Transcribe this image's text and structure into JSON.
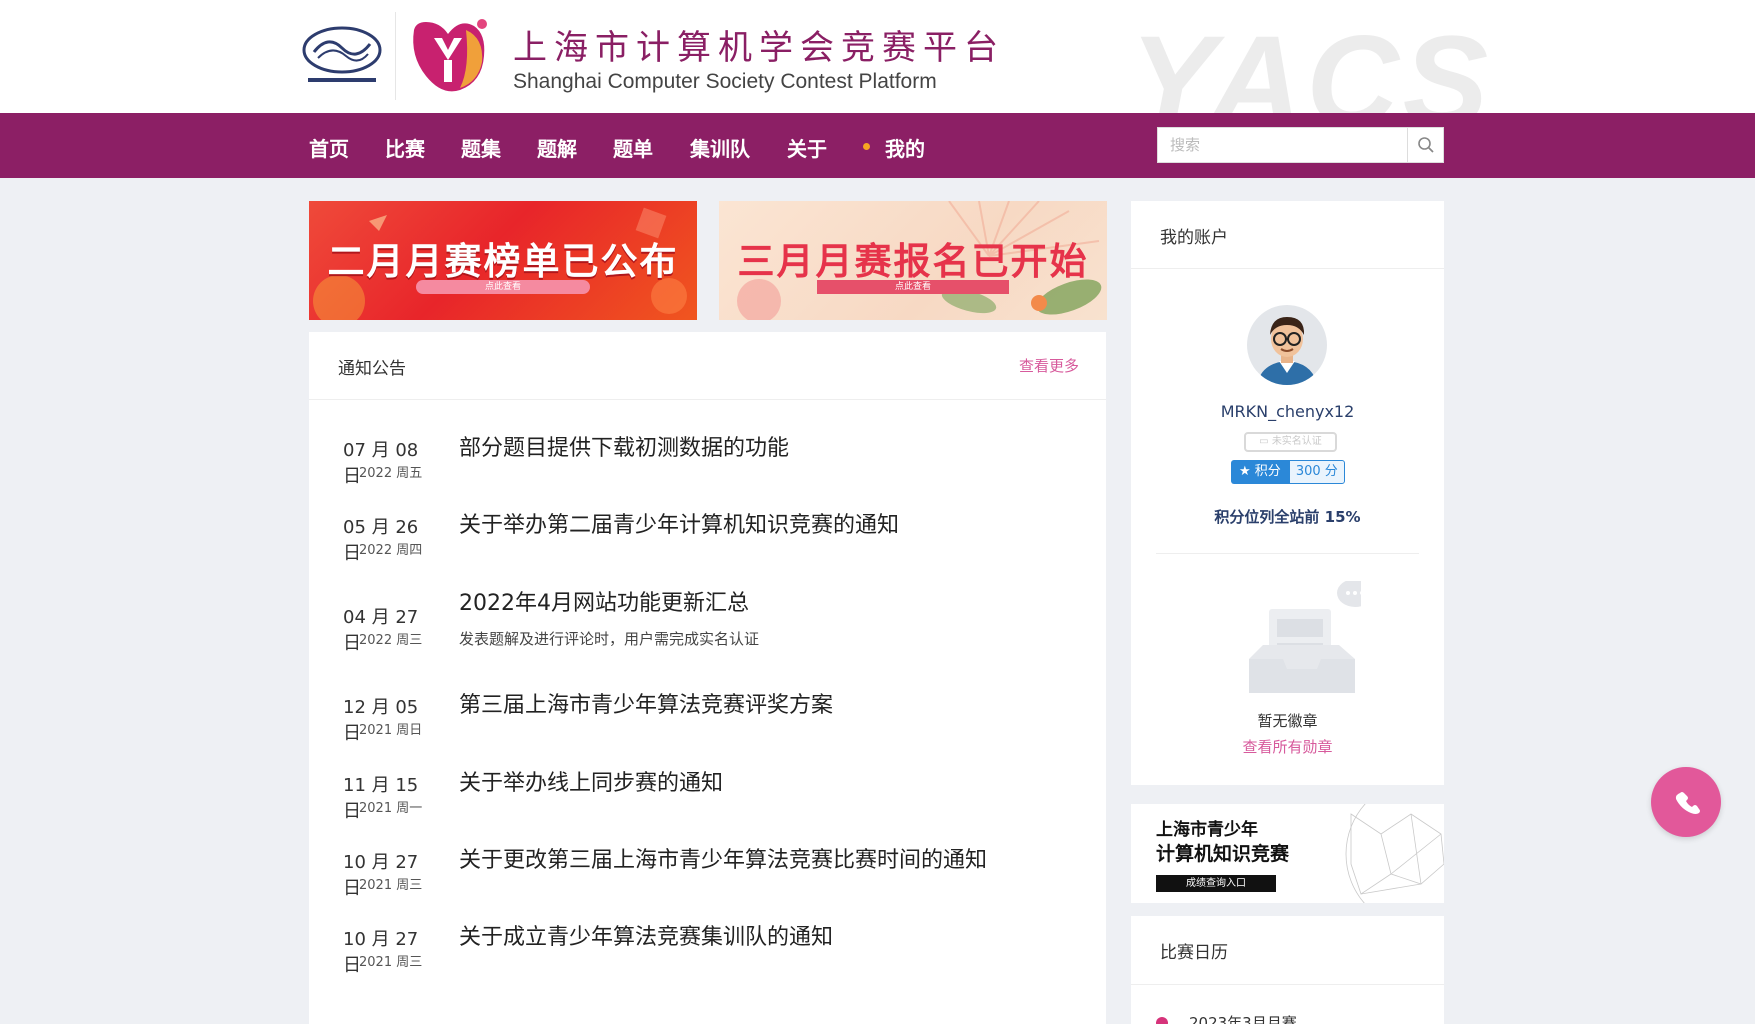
{
  "header": {
    "org_logo_icon": "shanghai-computer-society-logo",
    "platform_logo_icon": "yacs-y-logo",
    "title_cn": "上海市计算机学会竞赛平台",
    "title_en": "Shanghai Computer Society Contest Platform",
    "watermark": "YACS"
  },
  "nav": {
    "items": [
      "首页",
      "比赛",
      "题集",
      "题解",
      "题单",
      "集训队",
      "关于",
      "我的"
    ],
    "search_placeholder": "搜索",
    "search_icon": "search-icon"
  },
  "banners": [
    {
      "text": "二月月赛榜单已公布",
      "pill": "点此查看"
    },
    {
      "text": "三月月赛报名已开始",
      "pill": "点此查看"
    }
  ],
  "notices": {
    "title": "通知公告",
    "more": "查看更多",
    "items": [
      {
        "date": "07 月 08 日",
        "year": "2022 周五",
        "title": "部分题目提供下载初测数据的功能",
        "sub": ""
      },
      {
        "date": "05 月 26 日",
        "year": "2022 周四",
        "title": "关于举办第二届青少年计算机知识竞赛的通知",
        "sub": ""
      },
      {
        "date": "04 月 27 日",
        "year": "2022 周三",
        "title": "2022年4月网站功能更新汇总",
        "sub": "发表题解及进行评论时，用户需完成实名认证"
      },
      {
        "date": "12 月 05 日",
        "year": "2021 周日",
        "title": "第三届上海市青少年算法竞赛评奖方案",
        "sub": ""
      },
      {
        "date": "11 月 15 日",
        "year": "2021 周一",
        "title": "关于举办线上同步赛的通知",
        "sub": ""
      },
      {
        "date": "10 月 27 日",
        "year": "2021 周三",
        "title": "关于更改第三届上海市青少年算法竞赛比赛时间的通知",
        "sub": ""
      },
      {
        "date": "10 月 27 日",
        "year": "2021 周三",
        "title": "关于成立青少年算法竞赛集训队的通知",
        "sub": ""
      }
    ]
  },
  "account": {
    "title": "我的账户",
    "username": "MRKN_chenyx12",
    "realname_badge": "未实名认证",
    "points_label": "积分",
    "points_value": "300 分",
    "rank_text": "积分位列全站前 15%",
    "no_badge": "暂无徽章",
    "all_badges": "查看所有勋章"
  },
  "contest_banner": {
    "line1": "上海市青少年",
    "line2": "计算机知识竞赛",
    "button": "成绩查询入口"
  },
  "calendar": {
    "title": "比赛日历",
    "first_item": "2023年3月月赛"
  },
  "colors": {
    "brand": "#8c1f65",
    "accent": "#d75a9c",
    "phone_button": "#e2589a"
  }
}
